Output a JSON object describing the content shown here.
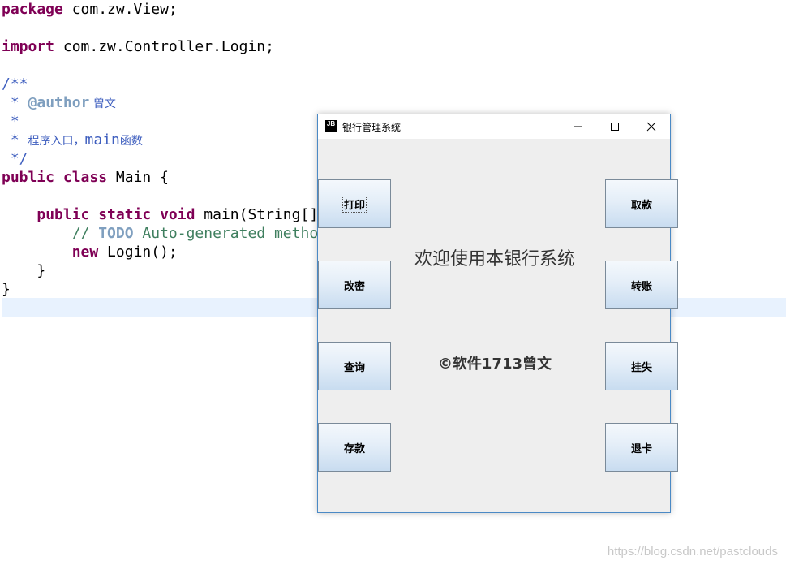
{
  "code": {
    "l1_kw": "package",
    "l1_rest": " com.zw.View;",
    "l2_kw": "import",
    "l2_rest": " com.zw.Controller.Login;",
    "l3": "/**",
    "l4_star": " * ",
    "l4_tag": "@author",
    "l4_name": " 曾文",
    "l5": " *",
    "l6_star": " * ",
    "l6_cjk": "程序入口，",
    "l6_main": "main",
    "l6_cjk2": "函数",
    "l7": " */",
    "l8_kw": "public class",
    "l8_rest": " Main {",
    "l9_indent": "    ",
    "l9_kw": "public static void",
    "l9_rest": " main(String[]",
    "l10_indent": "        ",
    "l10_slashes": "// ",
    "l10_todo": "TODO",
    "l10_rest": " Auto-generated metho",
    "l11_indent": "        ",
    "l11_kw": "new",
    "l11_rest": " Login();",
    "l12": "    }",
    "l13": "}"
  },
  "window": {
    "title": "银行管理系统",
    "icon_text": "JB",
    "welcome": "欢迎使用本银行系统",
    "copyright": "©软件1713曾文",
    "left_buttons": [
      "打印",
      "改密",
      "查询",
      "存款"
    ],
    "right_buttons": [
      "取款",
      "转账",
      "挂失",
      "退卡"
    ]
  },
  "watermark": "https://blog.csdn.net/pastclouds"
}
